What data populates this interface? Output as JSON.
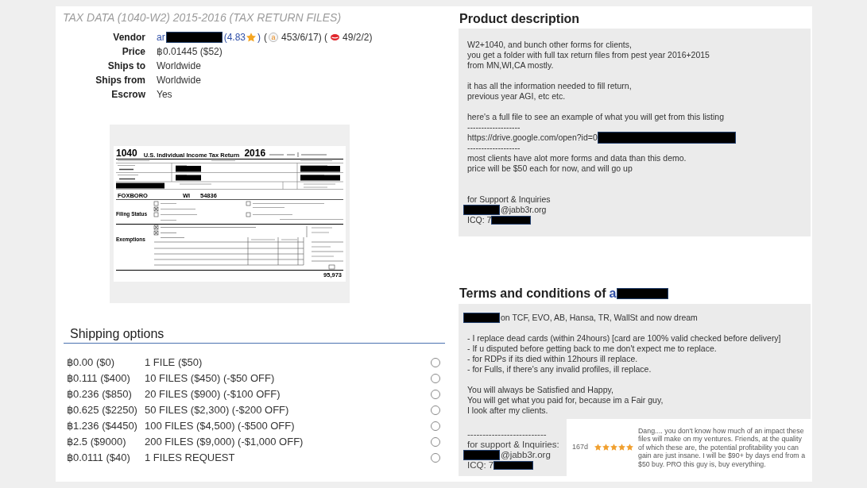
{
  "listing": {
    "title": "TAX DATA (1040-W2) 2015-2016 (TAX RETURN FILES)",
    "details": [
      {
        "label": "Vendor",
        "parts": [
          {
            "kind": "link",
            "text": "ar"
          },
          {
            "kind": "redaction"
          },
          {
            "kind": "link",
            "text": "(4.83"
          },
          {
            "kind": "star"
          },
          {
            "kind": "link",
            "text": ")"
          },
          {
            "kind": "text",
            "text": "("
          },
          {
            "kind": "badge",
            "text": "a"
          },
          {
            "kind": "text",
            "text": "453/6/17) ("
          },
          {
            "kind": "lips"
          },
          {
            "kind": "text",
            "text": "49/2/2)"
          }
        ]
      },
      {
        "label": "Price",
        "parts": [
          {
            "kind": "text",
            "text": "฿0.01445 ($52)"
          }
        ]
      },
      {
        "label": "Ships to",
        "parts": [
          {
            "kind": "text",
            "text": "Worldwide"
          }
        ]
      },
      {
        "label": "Ships from",
        "parts": [
          {
            "kind": "text",
            "text": "Worldwide"
          }
        ]
      },
      {
        "label": "Escrow",
        "parts": [
          {
            "kind": "text",
            "text": "Yes"
          }
        ]
      }
    ],
    "preview": {
      "form_number": "1040",
      "form_title": "U.S. Individual Income Tax Return",
      "year": "2016",
      "city": "FOXBORO",
      "state": "WI",
      "zip": "54836",
      "filing_label": "Filing Status",
      "exemptions_label": "Exemptions",
      "total": "95,973"
    }
  },
  "shipping": {
    "heading": "Shipping options",
    "options": [
      {
        "price": "฿0.00 ($0)",
        "label": "1 FILE ($50)",
        "selected": false
      },
      {
        "price": "฿0.111 ($400)",
        "label": "10 FILES ($450) (-$50 OFF)",
        "selected": false
      },
      {
        "price": "฿0.236 ($850)",
        "label": "20 FILES ($900) (-$100 OFF)",
        "selected": false
      },
      {
        "price": "฿0.625 ($2250)",
        "label": "50 FILES ($2,300) (-$200 OFF)",
        "selected": false
      },
      {
        "price": "฿1.236 ($4450)",
        "label": "100 FILES ($4,500) (-$500 OFF)",
        "selected": false
      },
      {
        "price": "฿2.5 ($9000)",
        "label": "200 FILES ($9,000) (-$1,000 OFF)",
        "selected": false
      },
      {
        "price": "฿0.0111 ($40)",
        "label": "1 FILES REQUEST",
        "selected": false
      }
    ]
  },
  "description": {
    "heading": "Product description",
    "paragraphs": [
      {
        "lines": [
          {
            "text": "W2+1040, and bunch other forms for clients,"
          },
          {
            "text": "you get a folder with full tax return files from pest year 2016+2015"
          },
          {
            "text": "from MN,WI,CA mostly."
          }
        ]
      },
      {
        "lines": [
          {
            "text": "it has all the information needed to fill return,"
          },
          {
            "text": "previous year AGI, etc etc."
          }
        ]
      },
      {
        "lines": [
          {
            "text": "here's a full file to see an example of what you will get from this listing"
          },
          {
            "text": "-------------------"
          },
          {
            "parts": [
              {
                "kind": "text",
                "text": "https://drive.google.com/open?id=0"
              },
              {
                "kind": "redaction",
                "wide": true
              }
            ]
          },
          {
            "text": "-------------------"
          },
          {
            "text": "most clients have alot more forms and data than this demo."
          },
          {
            "text": "price will be $50 each for now, and will go up"
          }
        ]
      },
      {
        "extra_space": true,
        "lines": [
          {
            "text": "for Support & Inquiries"
          },
          {
            "parts": [
              {
                "kind": "redaction"
              },
              {
                "kind": "text",
                "text": "@jabb3r.org"
              }
            ]
          },
          {
            "parts": [
              {
                "kind": "text",
                "text": "ICQ: 7"
              },
              {
                "kind": "redaction"
              }
            ]
          }
        ]
      }
    ]
  },
  "terms": {
    "heading": "Terms and conditions of",
    "vendor": "a",
    "paragraphs": [
      {
        "lines": [
          {
            "parts": [
              {
                "kind": "redaction"
              },
              {
                "kind": "text",
                "text": "on TCF, EVO, AB, Hansa, TR, WallSt and now dream"
              }
            ]
          }
        ]
      },
      {
        "lines": [
          {
            "text": "- I replace dead cards (within 24hours) [card are 100% valid checked before delivery]"
          },
          {
            "text": "- If u disputed before getting back to me don't expect me to replace."
          },
          {
            "text": "- for RDPs if its died within 12hours ill replace."
          },
          {
            "text": "- for Fulls, if there's any invalid profiles, ill replace."
          }
        ]
      },
      {
        "lines": [
          {
            "text": "You will always be Satisfied and Happy,"
          },
          {
            "text": "You will get what you paid for, because im a Fair guy,"
          },
          {
            "text": "I look after my clients."
          }
        ]
      }
    ],
    "support": {
      "lines": [
        {
          "text": "--------------------------"
        },
        {
          "text": "for support & Inquiries:"
        },
        {
          "parts": [
            {
              "kind": "redaction"
            },
            {
              "kind": "text",
              "text": "@jabb3r.org"
            }
          ]
        },
        {
          "parts": [
            {
              "kind": "text",
              "text": "ICQ: 7"
            },
            {
              "kind": "redaction"
            }
          ]
        }
      ]
    },
    "review": {
      "age": "167d",
      "stars": 5,
      "text": "Dang.... you don't know how much of an impact these files will make on my ventures. Friends, at the quality of which these are, the potential profitability you can gain are just insane. I will be $90+ by days end from a $50 buy. PRO this guy is, buy everything."
    }
  }
}
